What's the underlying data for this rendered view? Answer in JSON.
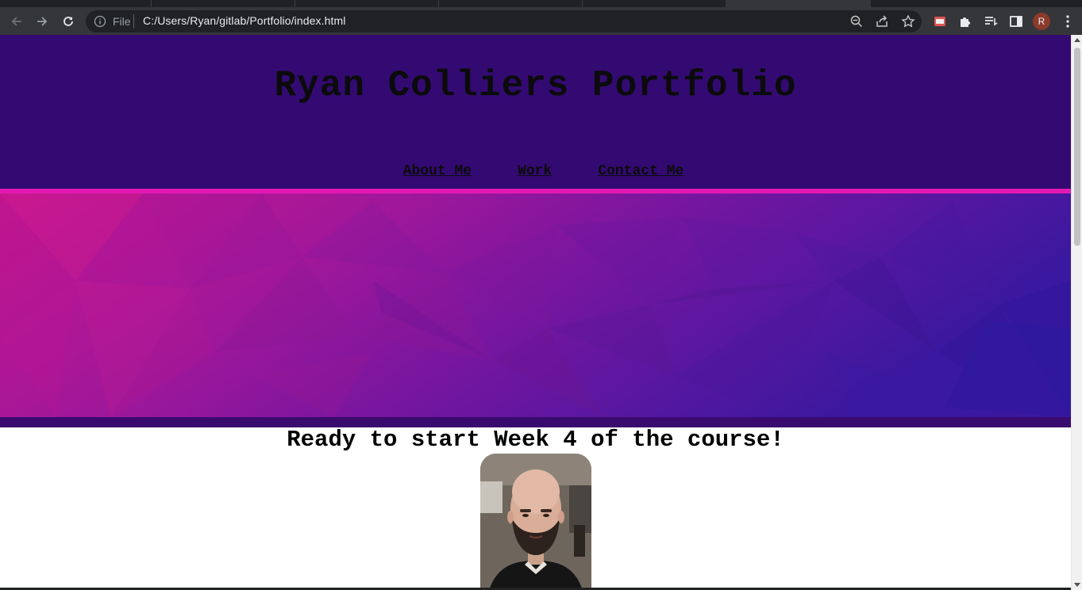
{
  "browser": {
    "omnibox": {
      "scheme_label": "File",
      "url": "C:/Users/Ryan/gitlab/Portfolio/index.html"
    },
    "profile_initial": "R",
    "icons": [
      "back-icon",
      "forward-icon",
      "reload-icon",
      "info-icon",
      "zoom-icon",
      "share-icon",
      "bookmark-star-icon",
      "extension-pdf-icon",
      "puzzle-icon",
      "reading-list-icon",
      "side-panel-icon",
      "menu-icon"
    ]
  },
  "site": {
    "title": "Ryan Colliers Portfolio",
    "nav": [
      "About Me",
      "Work",
      "Contact Me"
    ],
    "headline": "Ready to start Week 4 of the course!",
    "colors": {
      "header_bg": "#330a72",
      "accent_rule": "#e21ab3",
      "hero_pink": "#c7168f",
      "hero_purple": "#3a189f"
    }
  }
}
